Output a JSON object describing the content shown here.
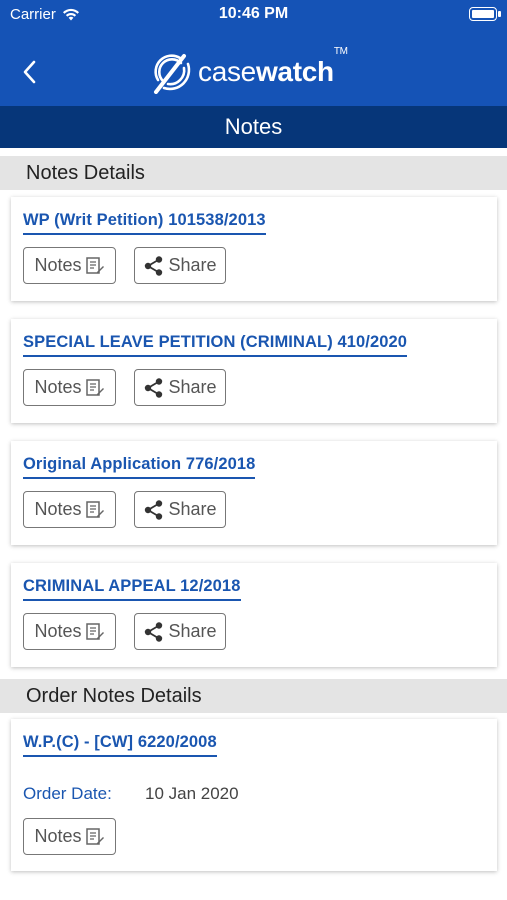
{
  "status_bar": {
    "carrier": "Carrier",
    "time": "10:46 PM"
  },
  "header": {
    "logo_light": "case",
    "logo_bold": "watch",
    "logo_tm": "TM",
    "title": "Notes"
  },
  "notes_section": {
    "heading": "Notes Details",
    "items": [
      {
        "case_title": "WP (Writ Petition) 101538/2013",
        "notes_label": "Notes",
        "share_label": "Share"
      },
      {
        "case_title": "SPECIAL LEAVE PETITION (CRIMINAL) 410/2020",
        "notes_label": "Notes",
        "share_label": "Share"
      },
      {
        "case_title": "Original Application 776/2018",
        "notes_label": "Notes",
        "share_label": "Share"
      },
      {
        "case_title": "CRIMINAL APPEAL 12/2018",
        "notes_label": "Notes",
        "share_label": "Share"
      }
    ]
  },
  "order_section": {
    "heading": "Order Notes Details",
    "items": [
      {
        "case_title": "W.P.(C) - [CW] 6220/2008",
        "order_date_label": "Order Date:",
        "order_date": "10 Jan 2020",
        "notes_label": "Notes"
      }
    ]
  },
  "colors": {
    "primary": "#1553b6",
    "title_bar": "#063679",
    "link": "#1a56b0",
    "section_bg": "#e4e4e4"
  },
  "icons": [
    "wifi-icon",
    "battery-icon",
    "back-chevron-icon",
    "casewatch-logo-icon",
    "notes-document-icon",
    "share-icon"
  ]
}
